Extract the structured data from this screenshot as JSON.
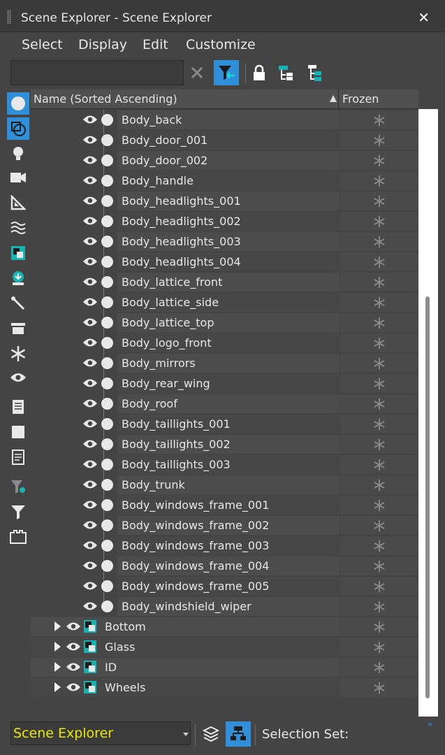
{
  "window": {
    "title": "Scene Explorer - Scene Explorer"
  },
  "menu": {
    "items": [
      "Select",
      "Display",
      "Edit",
      "Customize"
    ]
  },
  "toolbar": {
    "search_value": ""
  },
  "columns": {
    "name": "Name (Sorted Ascending)",
    "frozen": "Frozen"
  },
  "tree": {
    "children": [
      "Body_back",
      "Body_door_001",
      "Body_door_002",
      "Body_handle",
      "Body_headlights_001",
      "Body_headlights_002",
      "Body_headlights_003",
      "Body_headlights_004",
      "Body_lattice_front",
      "Body_lattice_side",
      "Body_lattice_top",
      "Body_logo_front",
      "Body_mirrors",
      "Body_rear_wing",
      "Body_roof",
      "Body_taillights_001",
      "Body_taillights_002",
      "Body_taillights_003",
      "Body_trunk",
      "Body_windows_frame_001",
      "Body_windows_frame_002",
      "Body_windows_frame_003",
      "Body_windows_frame_004",
      "Body_windows_frame_005",
      "Body_windshield_wiper"
    ],
    "layers": [
      "Bottom",
      "Glass",
      "ID",
      "Wheels"
    ]
  },
  "bottom": {
    "explorer_name": "Scene Explorer",
    "selection_set_label": "Selection Set:"
  },
  "colors": {
    "accent": "#2f8fd8",
    "combo_text": "#e8e800",
    "teal": "#17b3b3"
  }
}
